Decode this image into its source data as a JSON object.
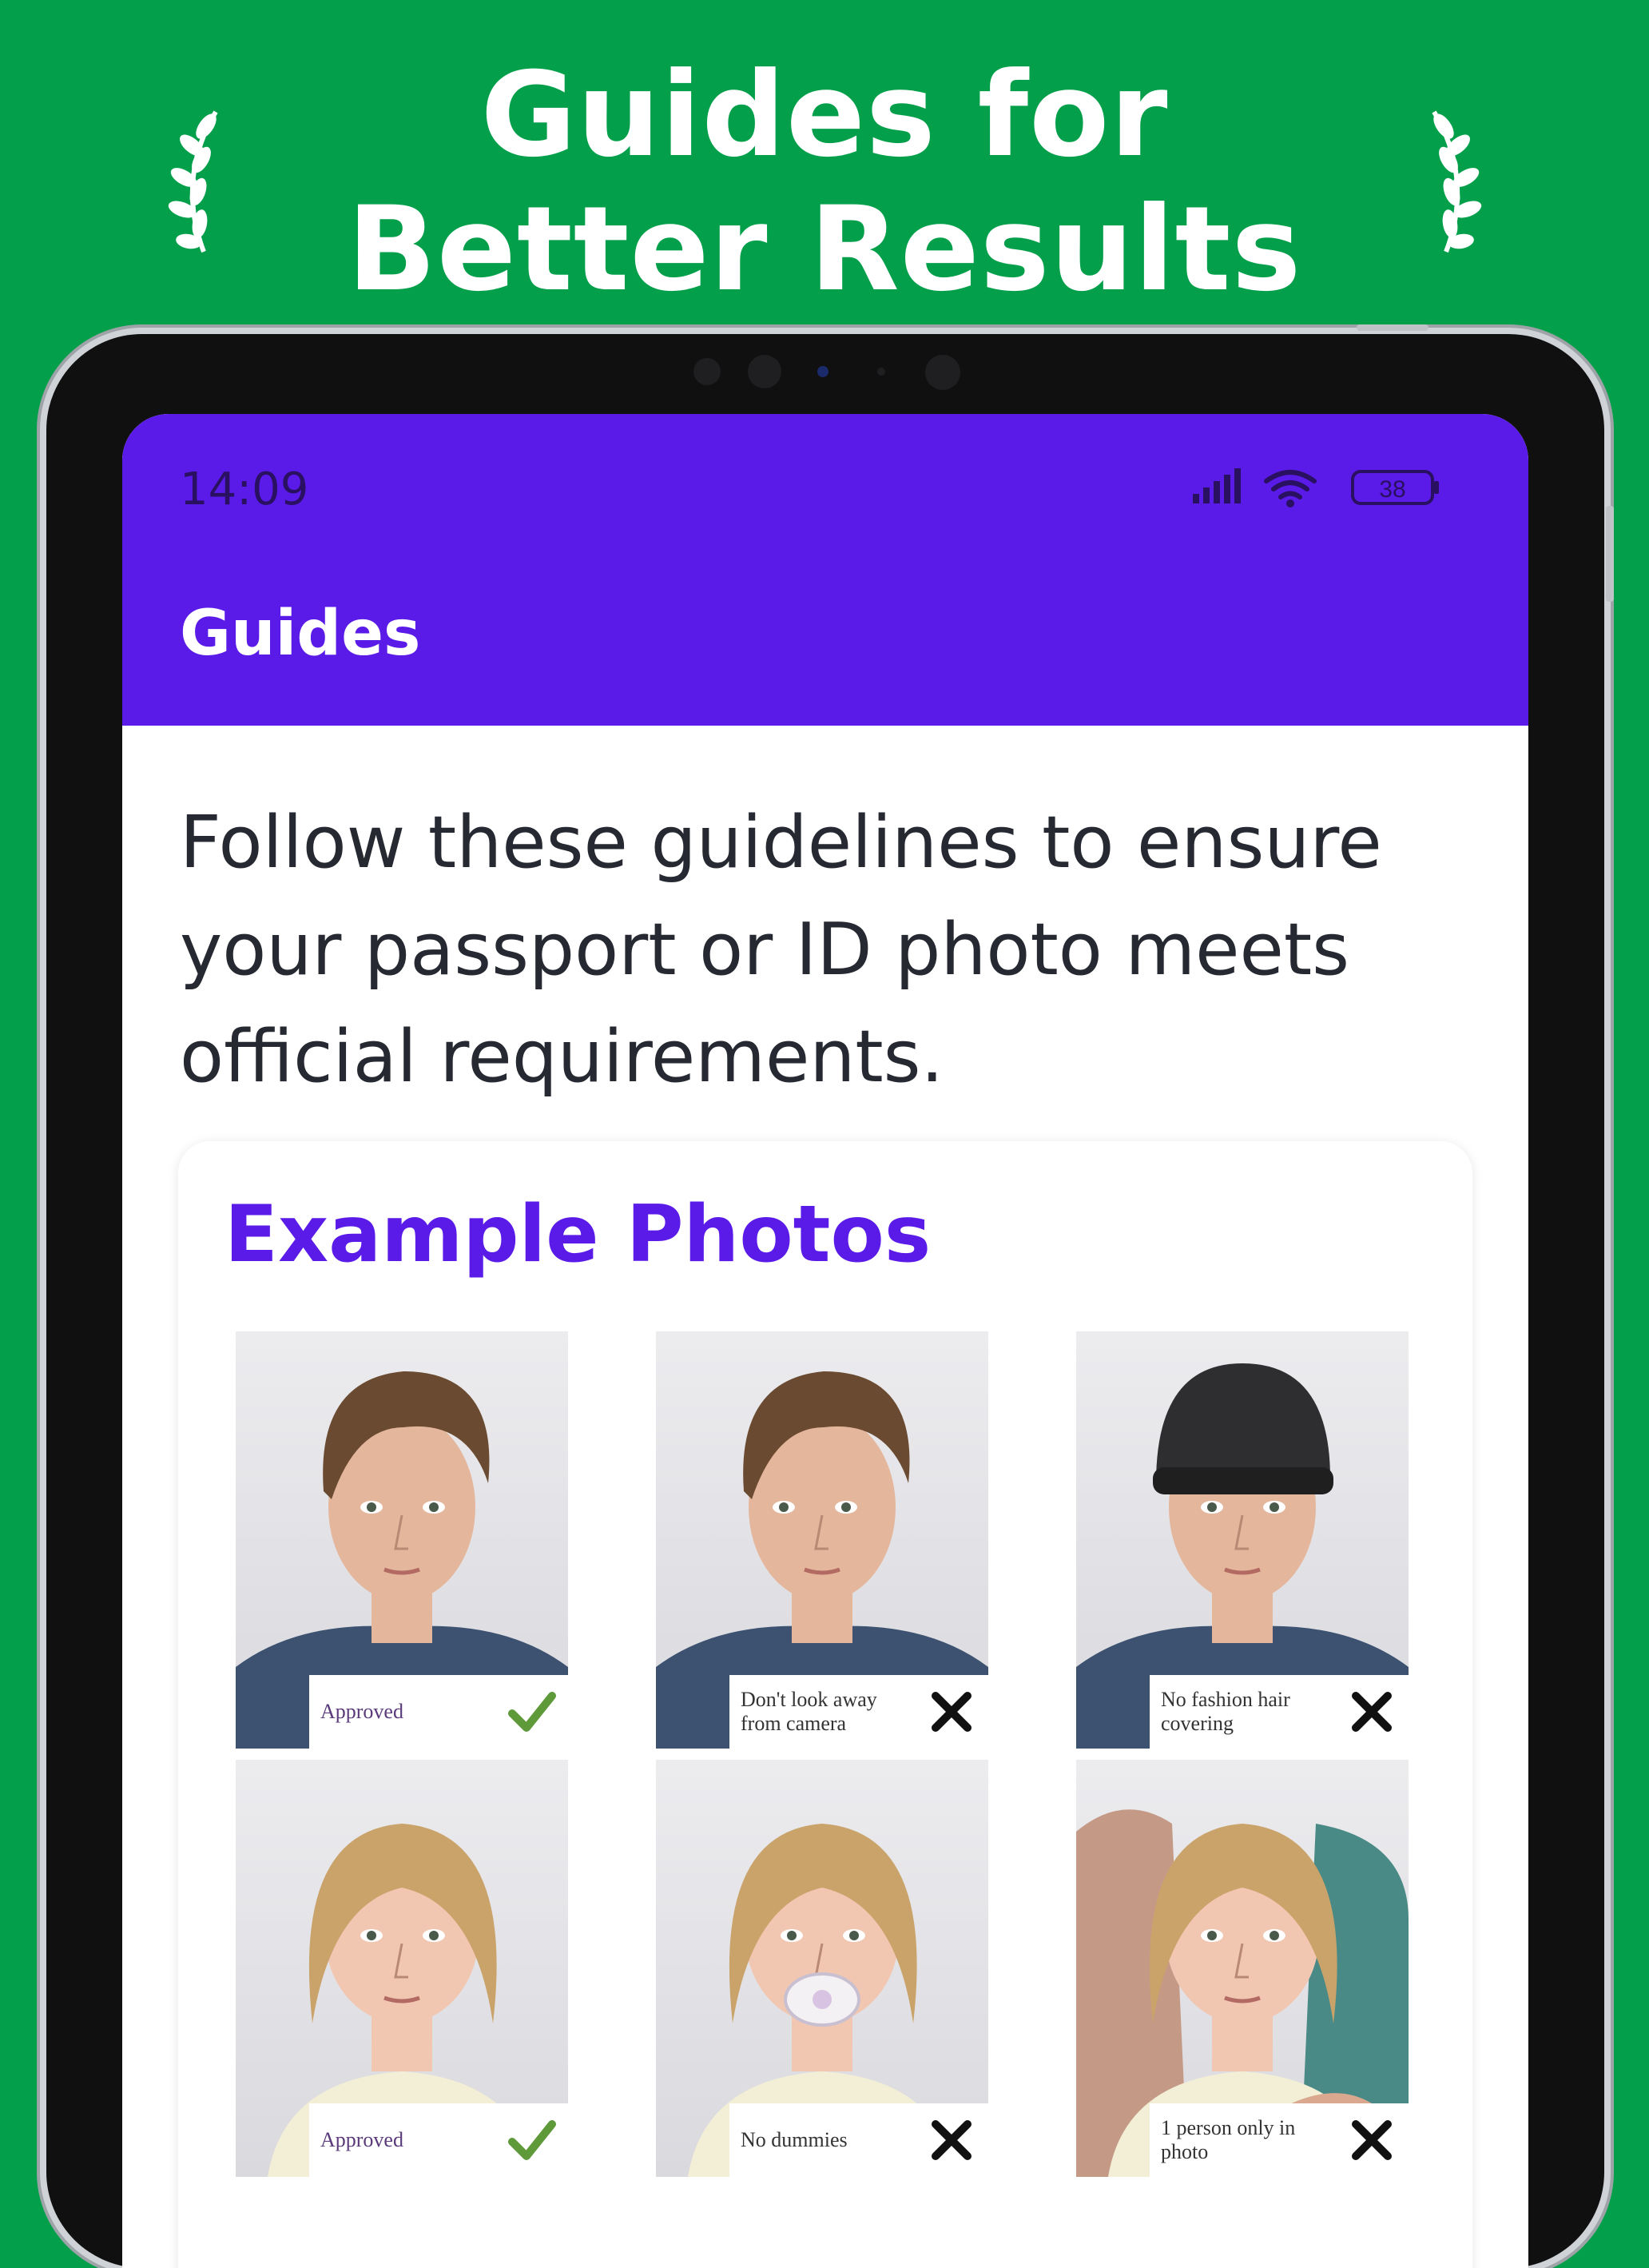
{
  "headline": {
    "line1": "Guides for",
    "line2": "Better Results"
  },
  "status_bar": {
    "time": "14:09",
    "battery": "38"
  },
  "app_bar": {
    "title": "Guides"
  },
  "intro_text": "Follow these guidelines to ensure your passport or ID photo meets official requirements.",
  "example_card": {
    "title": "Example Photos",
    "photos": [
      {
        "subject": "adult",
        "variant": "approved",
        "caption": "Approved",
        "mark": "check"
      },
      {
        "subject": "adult",
        "variant": "look-away",
        "caption": "Don't look away from camera",
        "mark": "cross"
      },
      {
        "subject": "adult",
        "variant": "hat",
        "caption": "No fashion hair covering",
        "mark": "cross"
      },
      {
        "subject": "child",
        "variant": "approved",
        "caption": "Approved",
        "mark": "check"
      },
      {
        "subject": "child",
        "variant": "dummy",
        "caption": "No dummies",
        "mark": "cross"
      },
      {
        "subject": "child",
        "variant": "held",
        "caption": "1 person only in photo",
        "mark": "cross"
      }
    ]
  },
  "colors": {
    "background": "#049f4a",
    "app_bar": "#5a1ae8",
    "accent": "#5a1ae8",
    "check": "#5e9a3a",
    "cross": "#111111"
  }
}
